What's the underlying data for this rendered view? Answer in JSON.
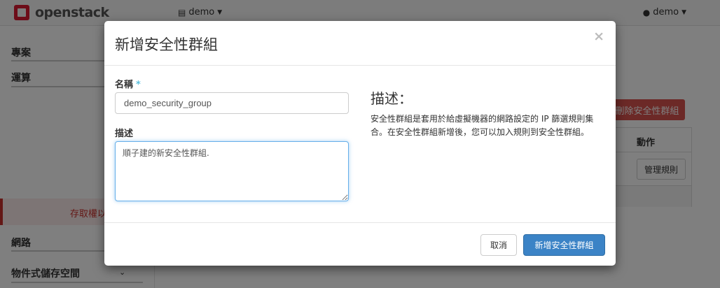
{
  "topbar": {
    "brand": "openstack",
    "project_menu": "demo",
    "user_menu": "demo",
    "icons": {
      "project": "server-icon",
      "user": "user-icon",
      "caret": "caret-down-icon"
    }
  },
  "sidebar": {
    "items": [
      {
        "label": "專案"
      },
      {
        "label": "運算"
      },
      {
        "label": "存取權以"
      },
      {
        "label": "網路"
      },
      {
        "label": "物件式儲存空間"
      }
    ],
    "icons": {
      "object_storage_caret": "chevron-down-icon"
    }
  },
  "background": {
    "delete_button": "刪除安全性群組",
    "table_header_actions": "動作",
    "manage_rules_button": "管理規則"
  },
  "modal": {
    "title": "新增安全性群組",
    "close_symbol": "×",
    "name_label": "名稱",
    "required_marker": "*",
    "name_value": "demo_security_group",
    "description_label": "描述",
    "description_value": "順子建的新安全性群組.",
    "help_title": "描述：",
    "help_text": "安全性群組是套用於給虛擬機器的網路設定的 IP 篩選規則集合。在安全性群組新增後，您可以加入規則到安全性群組。",
    "cancel_button": "取消",
    "submit_button": "新增安全性群組"
  },
  "colors": {
    "brand_red": "#da1a32",
    "danger": "#d9534f",
    "primary": "#3b83c6",
    "focus_border": "#66afe9"
  }
}
